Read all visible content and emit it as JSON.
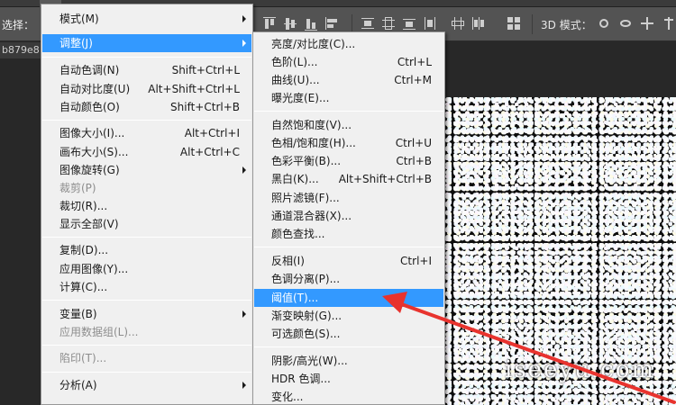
{
  "options_bar": {
    "left_label": "选择：",
    "mode3d_label": "3D 模式："
  },
  "document_tab": {
    "name": "b879e8"
  },
  "watermark": "iseeyu.com",
  "colors": {
    "menu_bg": "#f0f0f0",
    "highlight": "#3399ff",
    "annotation_arrow": "#e8332e"
  },
  "main_menu": {
    "items": [
      {
        "label": "模式(M)",
        "shortcut": "",
        "submenu": true,
        "disabled": false
      },
      {
        "label": "调整(J)",
        "shortcut": "",
        "submenu": true,
        "disabled": false,
        "highlighted": true
      },
      {
        "label": "自动色调(N)",
        "shortcut": "Shift+Ctrl+L",
        "disabled": false
      },
      {
        "label": "自动对比度(U)",
        "shortcut": "Alt+Shift+Ctrl+L",
        "disabled": false
      },
      {
        "label": "自动颜色(O)",
        "shortcut": "Shift+Ctrl+B",
        "disabled": false
      },
      {
        "label": "图像大小(I)...",
        "shortcut": "Alt+Ctrl+I",
        "disabled": false
      },
      {
        "label": "画布大小(S)...",
        "shortcut": "Alt+Ctrl+C",
        "disabled": false
      },
      {
        "label": "图像旋转(G)",
        "shortcut": "",
        "submenu": true,
        "disabled": false
      },
      {
        "label": "裁剪(P)",
        "shortcut": "",
        "disabled": true
      },
      {
        "label": "裁切(R)...",
        "shortcut": "",
        "disabled": false
      },
      {
        "label": "显示全部(V)",
        "shortcut": "",
        "disabled": false
      },
      {
        "label": "复制(D)...",
        "shortcut": "",
        "disabled": false
      },
      {
        "label": "应用图像(Y)...",
        "shortcut": "",
        "disabled": false
      },
      {
        "label": "计算(C)...",
        "shortcut": "",
        "disabled": false
      },
      {
        "label": "变量(B)",
        "shortcut": "",
        "submenu": true,
        "disabled": false
      },
      {
        "label": "应用数据组(L)...",
        "shortcut": "",
        "disabled": true
      },
      {
        "label": "陷印(T)...",
        "shortcut": "",
        "disabled": true
      },
      {
        "label": "分析(A)",
        "shortcut": "",
        "submenu": true,
        "disabled": false
      }
    ]
  },
  "sub_menu": {
    "items": [
      {
        "label": "亮度/对比度(C)...",
        "shortcut": ""
      },
      {
        "label": "色阶(L)...",
        "shortcut": "Ctrl+L"
      },
      {
        "label": "曲线(U)...",
        "shortcut": "Ctrl+M"
      },
      {
        "label": "曝光度(E)...",
        "shortcut": ""
      },
      {
        "label": "自然饱和度(V)...",
        "shortcut": ""
      },
      {
        "label": "色相/饱和度(H)...",
        "shortcut": "Ctrl+U"
      },
      {
        "label": "色彩平衡(B)...",
        "shortcut": "Ctrl+B"
      },
      {
        "label": "黑白(K)...",
        "shortcut": "Alt+Shift+Ctrl+B"
      },
      {
        "label": "照片滤镜(F)...",
        "shortcut": ""
      },
      {
        "label": "通道混合器(X)...",
        "shortcut": ""
      },
      {
        "label": "颜色查找...",
        "shortcut": ""
      },
      {
        "label": "反相(I)",
        "shortcut": "Ctrl+I"
      },
      {
        "label": "色调分离(P)...",
        "shortcut": ""
      },
      {
        "label": "阈值(T)...",
        "shortcut": "",
        "highlighted": true
      },
      {
        "label": "渐变映射(G)...",
        "shortcut": ""
      },
      {
        "label": "可选颜色(S)...",
        "shortcut": ""
      },
      {
        "label": "阴影/高光(W)...",
        "shortcut": ""
      },
      {
        "label": "HDR 色调...",
        "shortcut": ""
      },
      {
        "label": "变化...",
        "shortcut": ""
      }
    ]
  }
}
